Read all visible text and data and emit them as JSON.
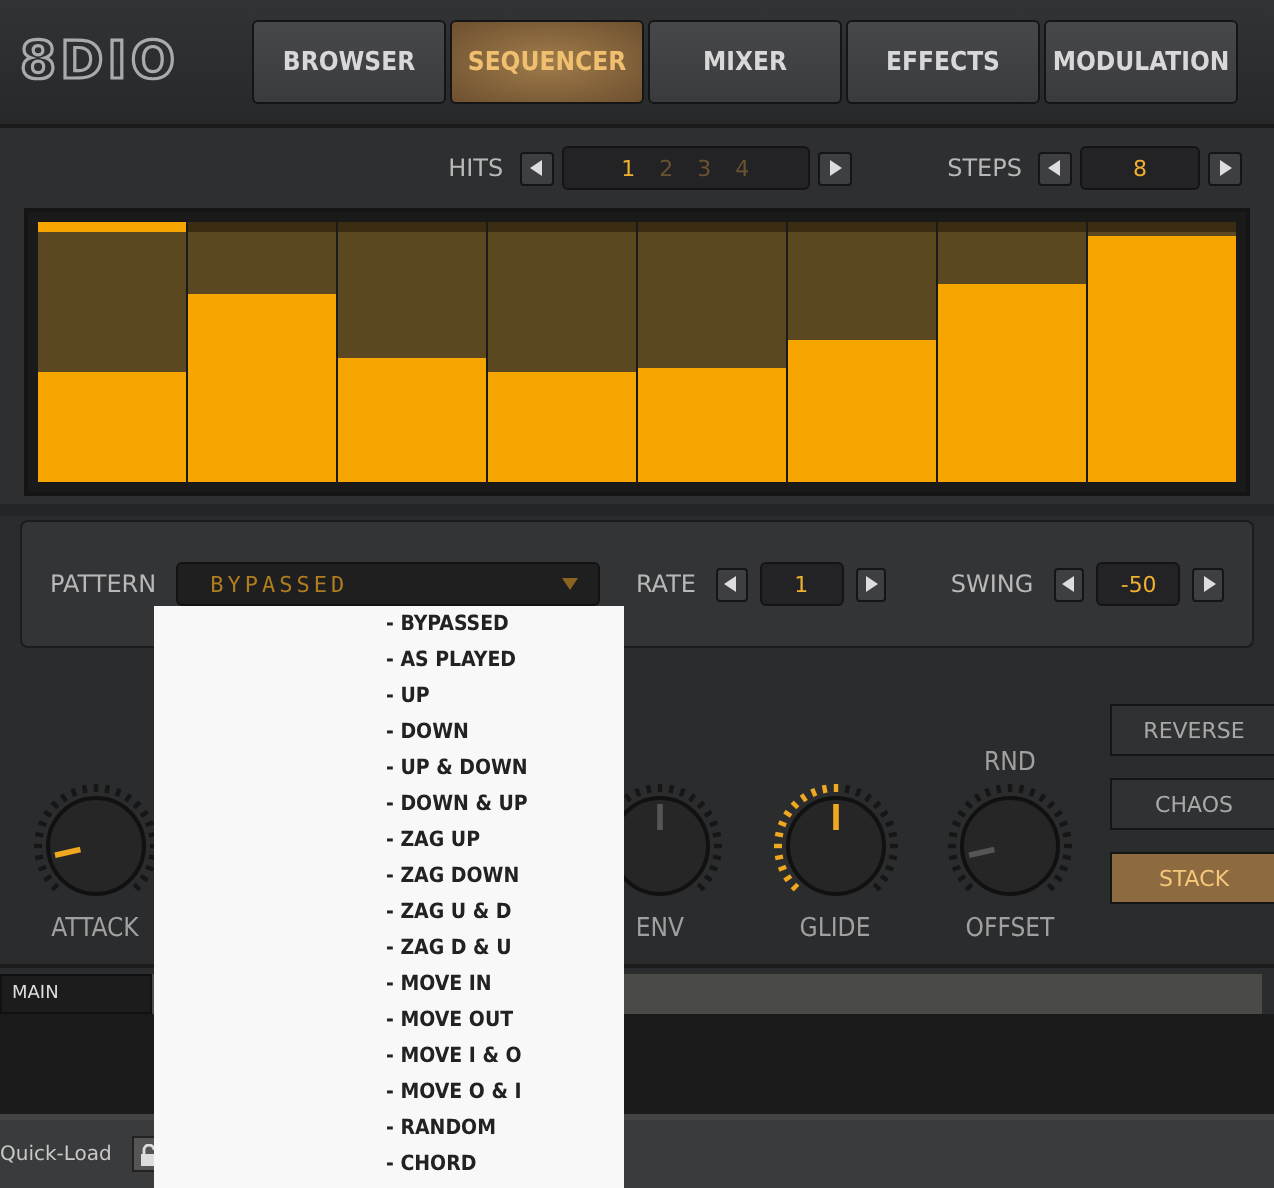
{
  "logo": "8DIO",
  "tabs": [
    {
      "label": "BROWSER",
      "selected": false
    },
    {
      "label": "SEQUENCER",
      "selected": true
    },
    {
      "label": "MIXER",
      "selected": false
    },
    {
      "label": "EFFECTS",
      "selected": false
    },
    {
      "label": "MODULATION",
      "selected": false
    }
  ],
  "hits": {
    "label": "HITS",
    "values": [
      {
        "label": "1",
        "selected": true
      },
      {
        "label": "2",
        "selected": false
      },
      {
        "label": "3",
        "selected": false
      },
      {
        "label": "4",
        "selected": false
      }
    ]
  },
  "steps": {
    "label": "STEPS",
    "value": "8"
  },
  "sequencer_steps": [
    {
      "level": 0.42,
      "active": true
    },
    {
      "level": 0.72,
      "active": false
    },
    {
      "level": 0.48,
      "active": false
    },
    {
      "level": 0.42,
      "active": false
    },
    {
      "level": 0.44,
      "active": false
    },
    {
      "level": 0.55,
      "active": false
    },
    {
      "level": 0.76,
      "active": false
    },
    {
      "level": 0.95,
      "active": false
    }
  ],
  "pattern": {
    "label": "PATTERN",
    "value": "BYPASSED",
    "options": [
      "- BYPASSED",
      "- AS PLAYED",
      "- UP",
      "- DOWN",
      "- UP & DOWN",
      "- DOWN & UP",
      "- ZAG UP",
      "- ZAG DOWN",
      "- ZAG U & D",
      "- ZAG D & U",
      "- MOVE IN",
      "- MOVE OUT",
      "- MOVE I & O",
      "- MOVE O & I",
      "- RANDOM",
      "- CHORD"
    ]
  },
  "rate": {
    "label": "RATE",
    "value": "1"
  },
  "swing": {
    "label": "SWING",
    "value": "-50"
  },
  "knobs": [
    {
      "label": "ATTACK",
      "level": 0.12,
      "ring_lit": false
    },
    {
      "label": "ENV",
      "level": 0.5,
      "ring_lit": false
    },
    {
      "label": "GLIDE",
      "level": 0.5,
      "ring_lit": true
    },
    {
      "label": "OFFSET",
      "top_label": "RND",
      "level": 0.12,
      "ring_lit": false
    }
  ],
  "mode_buttons": [
    {
      "label": "REVERSE",
      "on": false
    },
    {
      "label": "CHAOS",
      "on": false
    },
    {
      "label": "STACK",
      "on": true
    }
  ],
  "main_bar": {
    "label": "MAIN"
  },
  "status_bar": {
    "label": "Quick-Load"
  }
}
